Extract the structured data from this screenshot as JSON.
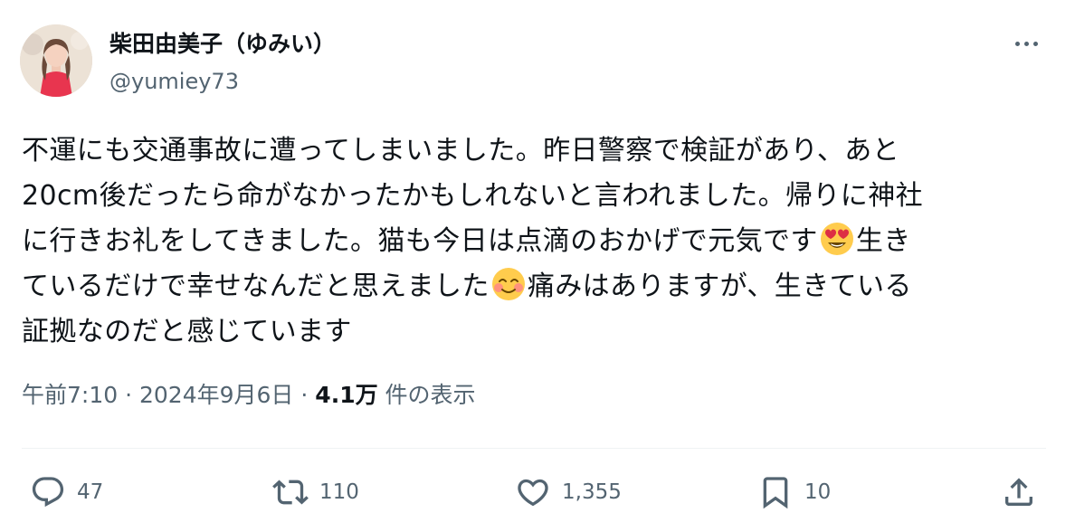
{
  "author": {
    "display_name": "柴田由美子（ゆみい）",
    "handle": "@yumiey73"
  },
  "tweet": {
    "lines": [
      {
        "parts": [
          {
            "t": "不運にも交通事故に遭ってしまいました。昨日警察で検証があり、あと"
          }
        ]
      },
      {
        "parts": [
          {
            "t": "20cm後だったら命がなかったかもしれないと言われました。帰りに神社"
          }
        ]
      },
      {
        "parts": [
          {
            "t": "に行きお礼をしてきました。猫も今日は点滴のおかげで元気です"
          },
          {
            "emoji": "smiling-face-with-heart-eyes-emoji"
          },
          {
            "t": "生き"
          }
        ]
      },
      {
        "parts": [
          {
            "t": "ているだけで幸せなんだと思えました"
          },
          {
            "emoji": "smiling-face-emoji"
          },
          {
            "t": "痛みはありますが、生きている"
          }
        ]
      },
      {
        "parts": [
          {
            "t": "証拠なのだと感じています"
          }
        ]
      }
    ]
  },
  "meta": {
    "time": "午前7:10",
    "separator": "·",
    "date": "2024年9月6日",
    "views_count": "4.1万",
    "views_label": "件の表示"
  },
  "actions": {
    "reply": {
      "icon": "reply-icon",
      "count": "47"
    },
    "retweet": {
      "icon": "retweet-icon",
      "count": "110"
    },
    "like": {
      "icon": "heart-icon",
      "count": "1,355"
    },
    "bookmark": {
      "icon": "bookmark-icon",
      "count": "10"
    },
    "share": {
      "icon": "share-icon"
    }
  },
  "icons": {
    "avatar": "avatar-photo",
    "more": "more-options-icon"
  },
  "colors": {
    "text": "#0f1419",
    "secondary": "#536471",
    "divider": "#eff3f4"
  }
}
